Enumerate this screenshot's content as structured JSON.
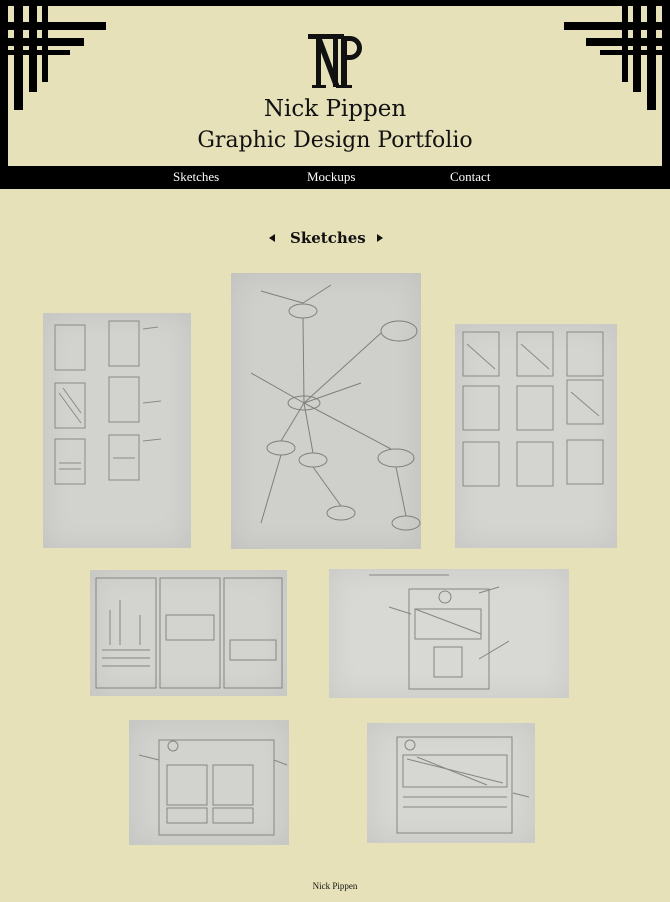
{
  "header": {
    "name": "Nick Pippen",
    "subtitle": "Graphic Design Portfolio"
  },
  "nav": {
    "items": [
      {
        "label": "Sketches"
      },
      {
        "label": "Mockups"
      },
      {
        "label": "Contact"
      }
    ]
  },
  "gallery": {
    "title": "Sketches"
  },
  "footer": {
    "text": "Nick Pippen"
  }
}
